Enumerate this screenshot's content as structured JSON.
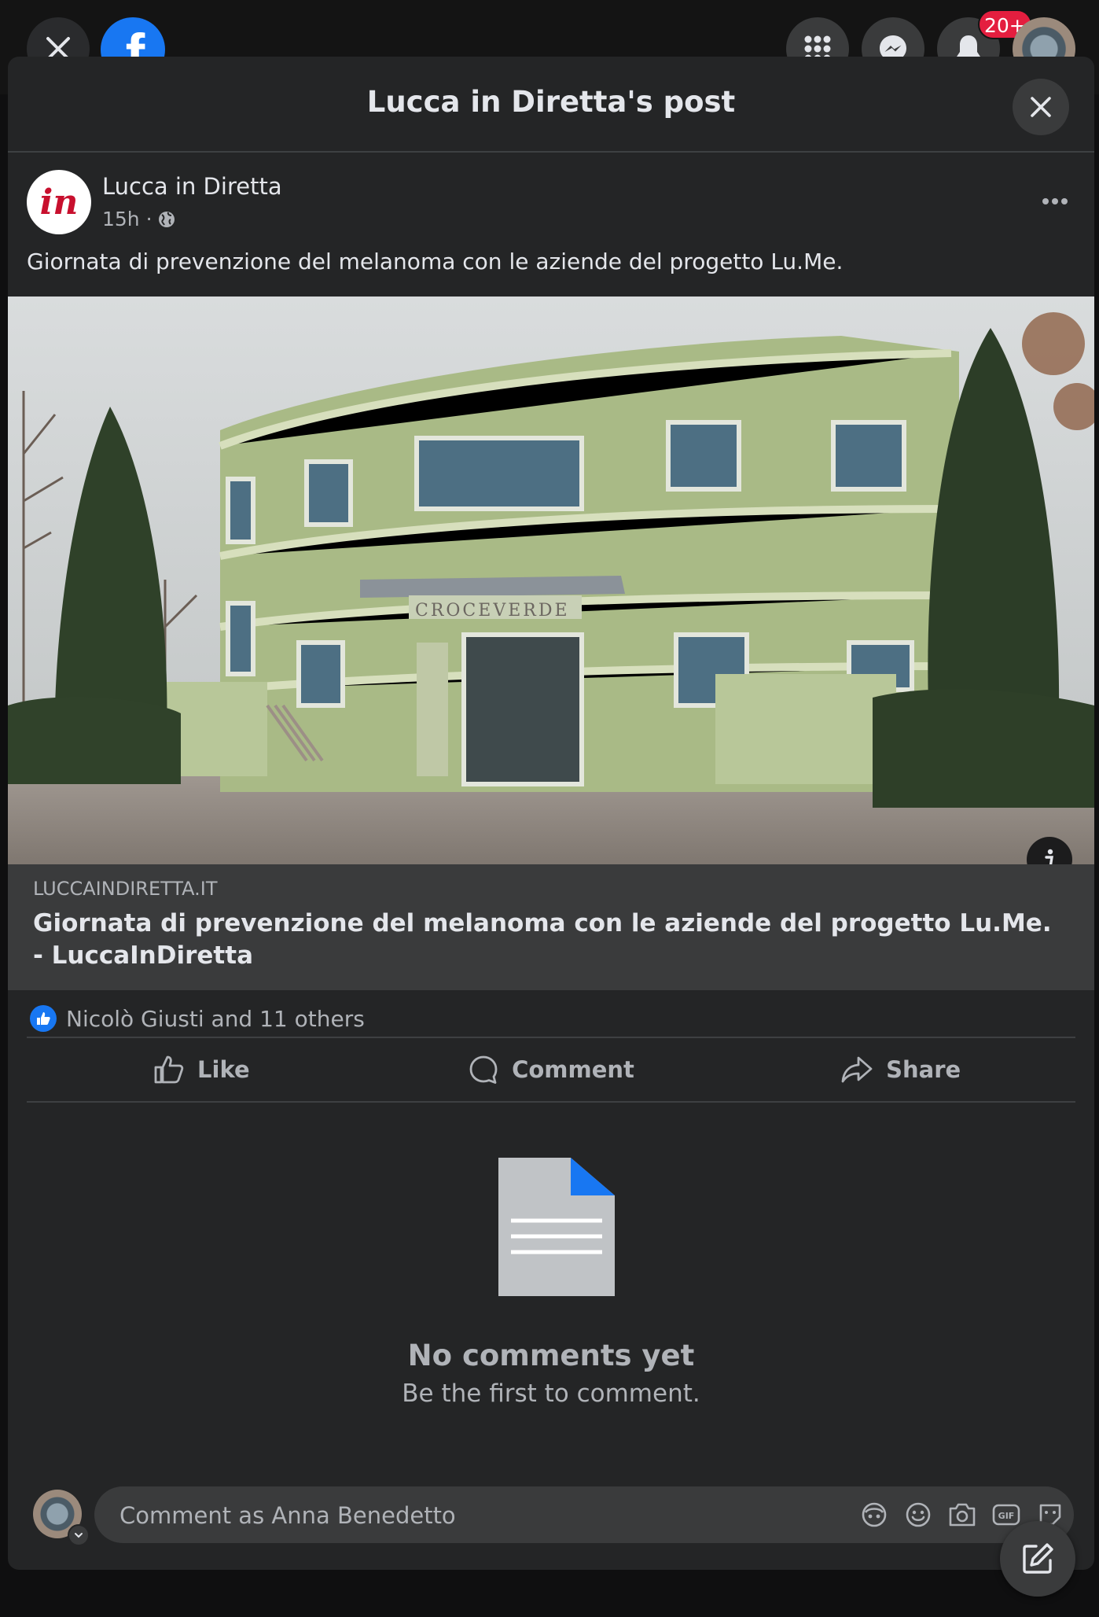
{
  "topbar": {
    "brand_letter": "f",
    "notification_count": "20+"
  },
  "modal": {
    "title": "Lucca in Diretta's post"
  },
  "post": {
    "avatar_text": "in",
    "author": "Lucca in Diretta",
    "time": "15h ·",
    "text": "Giornata di prevenzione del melanoma con le aziende del progetto Lu.Me.",
    "image_sign_text": "CROCEVERDE",
    "link": {
      "domain": "LUCCAINDIRETTA.IT",
      "title": "Giornata di prevenzione del melanoma con le aziende del progetto Lu.Me. - LuccaInDiretta"
    },
    "reactions_text": "Nicolò Giusti and 11 others",
    "actions": {
      "like": "Like",
      "comment": "Comment",
      "share": "Share"
    }
  },
  "comments": {
    "empty_title": "No comments yet",
    "empty_subtitle": "Be the first to comment."
  },
  "composer": {
    "placeholder": "Comment as Anna Benedetto",
    "gif_label": "GIF"
  },
  "colors": {
    "brand": "#1877f2",
    "surface": "#242526",
    "badge": "#e41e3f"
  }
}
